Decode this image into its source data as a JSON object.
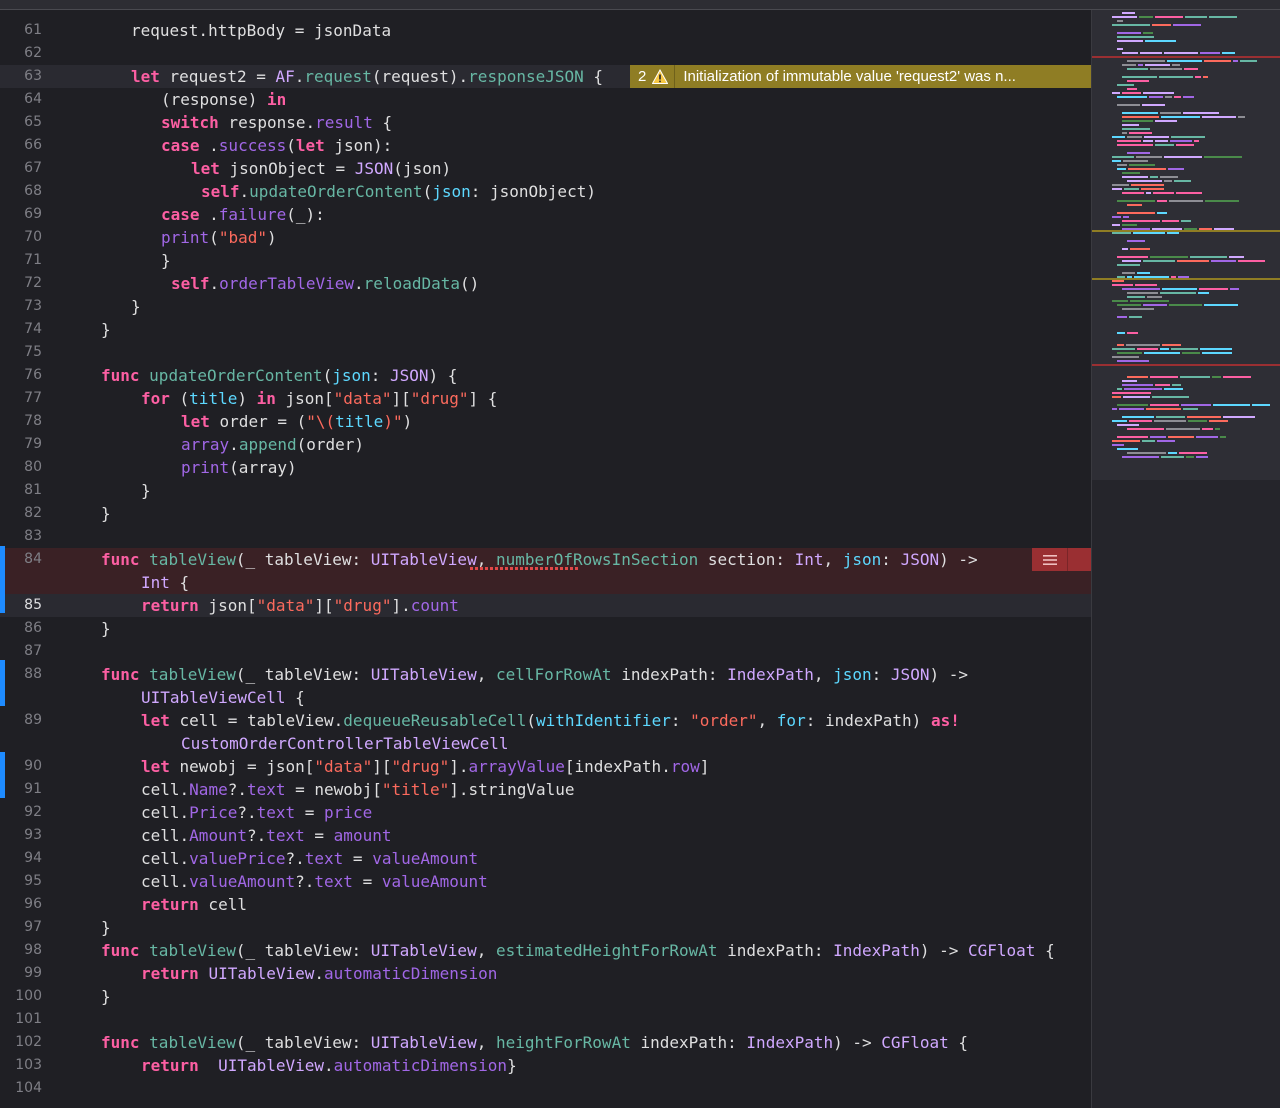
{
  "colors": {
    "keyword": "#fc5fa3",
    "type": "#d0a8ff",
    "function": "#67b7a4",
    "property": "#a167e6",
    "parameter_label": "#5dd8ff",
    "string": "#fc6a5d",
    "plain": "#dfdfe0",
    "warning_bg": "#8f7d24",
    "error_bg": "#9a2f32",
    "change_marker": "#1e8bff"
  },
  "editor": {
    "lines": [
      {
        "n": "61",
        "indent": 131,
        "tokens": [
          [
            "request.httpBody = jsonData",
            "pl"
          ]
        ]
      },
      {
        "n": "62",
        "indent": 131,
        "tokens": []
      },
      {
        "n": "63",
        "indent": 131,
        "hl": true,
        "tokens": [
          [
            "let",
            "k"
          ],
          [
            " request2 = ",
            "pl"
          ],
          [
            "AF",
            "ty"
          ],
          [
            ".",
            "pl"
          ],
          [
            "request",
            "fn"
          ],
          [
            "(request).",
            "pl"
          ],
          [
            "responseJSON",
            "fn"
          ],
          [
            " {",
            "pl"
          ]
        ]
      },
      {
        "n": "64",
        "indent": 161,
        "tokens": [
          [
            "(response) ",
            "pl"
          ],
          [
            "in",
            "k"
          ]
        ]
      },
      {
        "n": "65",
        "indent": 161,
        "tokens": [
          [
            "switch",
            "k"
          ],
          [
            " response.",
            "pl"
          ],
          [
            "result",
            "pr"
          ],
          [
            " {",
            "pl"
          ]
        ]
      },
      {
        "n": "66",
        "indent": 161,
        "tokens": [
          [
            "case",
            "k"
          ],
          [
            " .",
            "pl"
          ],
          [
            "success",
            "pr"
          ],
          [
            "(",
            "pl"
          ],
          [
            "let",
            "k"
          ],
          [
            " json):",
            "pl"
          ]
        ]
      },
      {
        "n": "67",
        "indent": 191,
        "tokens": [
          [
            "let",
            "k"
          ],
          [
            " jsonObject = ",
            "pl"
          ],
          [
            "JSON",
            "ty"
          ],
          [
            "(json)",
            "pl"
          ]
        ]
      },
      {
        "n": "68",
        "indent": 201,
        "tokens": [
          [
            "self",
            "k"
          ],
          [
            ".",
            "pl"
          ],
          [
            "updateOrderContent",
            "fn"
          ],
          [
            "(",
            "pl"
          ],
          [
            "json",
            "lp"
          ],
          [
            ": jsonObject)",
            "pl"
          ]
        ]
      },
      {
        "n": "69",
        "indent": 161,
        "tokens": [
          [
            "case",
            "k"
          ],
          [
            " .",
            "pl"
          ],
          [
            "failure",
            "pr"
          ],
          [
            "(_):",
            "pl"
          ]
        ]
      },
      {
        "n": "70",
        "indent": 161,
        "tokens": [
          [
            "print",
            "pr"
          ],
          [
            "(",
            "pl"
          ],
          [
            "\"bad\"",
            "st"
          ],
          [
            ")",
            "pl"
          ]
        ]
      },
      {
        "n": "71",
        "indent": 161,
        "tokens": [
          [
            "}",
            "pl"
          ]
        ]
      },
      {
        "n": "72",
        "indent": 171,
        "tokens": [
          [
            "self",
            "k"
          ],
          [
            ".",
            "pl"
          ],
          [
            "orderTableView",
            "pr"
          ],
          [
            ".",
            "pl"
          ],
          [
            "reloadData",
            "fn"
          ],
          [
            "()",
            "pl"
          ]
        ]
      },
      {
        "n": "73",
        "indent": 131,
        "tokens": [
          [
            "}",
            "pl"
          ]
        ]
      },
      {
        "n": "74",
        "indent": 101,
        "tokens": [
          [
            "}",
            "pl"
          ]
        ]
      },
      {
        "n": "75",
        "indent": 101,
        "tokens": []
      },
      {
        "n": "76",
        "indent": 101,
        "tokens": [
          [
            "func",
            "k"
          ],
          [
            " ",
            "pl"
          ],
          [
            "updateOrderContent",
            "fn"
          ],
          [
            "(",
            "pl"
          ],
          [
            "json",
            "lp"
          ],
          [
            ": ",
            "pl"
          ],
          [
            "JSON",
            "ty"
          ],
          [
            ") {",
            "pl"
          ]
        ]
      },
      {
        "n": "77",
        "indent": 141,
        "tokens": [
          [
            "for",
            "k"
          ],
          [
            " (",
            "pl"
          ],
          [
            "title",
            "lp"
          ],
          [
            ") ",
            "pl"
          ],
          [
            "in",
            "k"
          ],
          [
            " json[",
            "pl"
          ],
          [
            "\"data\"",
            "st"
          ],
          [
            "][",
            "pl"
          ],
          [
            "\"drug\"",
            "st"
          ],
          [
            "] {",
            "pl"
          ]
        ]
      },
      {
        "n": "78",
        "indent": 181,
        "tokens": [
          [
            "let",
            "k"
          ],
          [
            " order = (",
            "pl"
          ],
          [
            "\"\\(",
            "st"
          ],
          [
            "title",
            "lp"
          ],
          [
            ")\"",
            "st"
          ],
          [
            ")",
            "pl"
          ]
        ]
      },
      {
        "n": "79",
        "indent": 181,
        "tokens": [
          [
            "array",
            "pr"
          ],
          [
            ".",
            "pl"
          ],
          [
            "append",
            "fn"
          ],
          [
            "(order)",
            "pl"
          ]
        ]
      },
      {
        "n": "80",
        "indent": 181,
        "tokens": [
          [
            "print",
            "pr"
          ],
          [
            "(array)",
            "pl"
          ]
        ]
      },
      {
        "n": "81",
        "indent": 141,
        "tokens": [
          [
            "}",
            "pl"
          ]
        ]
      },
      {
        "n": "82",
        "indent": 101,
        "tokens": [
          [
            "}",
            "pl"
          ]
        ]
      },
      {
        "n": "83",
        "indent": 101,
        "tokens": []
      },
      {
        "n": "84",
        "indent": 101,
        "err": true,
        "tokens": [
          [
            "func",
            "k"
          ],
          [
            " ",
            "pl"
          ],
          [
            "tableView",
            "fn"
          ],
          [
            "(_ tableView: ",
            "pl"
          ],
          [
            "UITableView",
            "ty"
          ],
          [
            ", ",
            "pl"
          ],
          [
            "numberOfRowsInSection",
            "fn"
          ],
          [
            " section: ",
            "pl"
          ],
          [
            "Int",
            "ty"
          ],
          [
            ", ",
            "pl"
          ],
          [
            "json",
            "lp"
          ],
          [
            ": ",
            "pl"
          ],
          [
            "JSON",
            "ty"
          ],
          [
            ") ->",
            "pl"
          ]
        ]
      },
      {
        "n": "",
        "indent": 141,
        "err": true,
        "tokens": [
          [
            "Int",
            "ty"
          ],
          [
            " {",
            "pl"
          ]
        ]
      },
      {
        "n": "85",
        "indent": 141,
        "hl": true,
        "cur": true,
        "tokens": [
          [
            "return",
            "k"
          ],
          [
            " json[",
            "pl"
          ],
          [
            "\"data\"",
            "st"
          ],
          [
            "][",
            "pl"
          ],
          [
            "\"drug\"",
            "st"
          ],
          [
            "].",
            "pl"
          ],
          [
            "count",
            "pr"
          ]
        ]
      },
      {
        "n": "86",
        "indent": 101,
        "tokens": [
          [
            "}",
            "pl"
          ]
        ]
      },
      {
        "n": "87",
        "indent": 101,
        "tokens": []
      },
      {
        "n": "88",
        "indent": 101,
        "tokens": [
          [
            "func",
            "k"
          ],
          [
            " ",
            "pl"
          ],
          [
            "tableView",
            "fn"
          ],
          [
            "(_ tableView: ",
            "pl"
          ],
          [
            "UITableView",
            "ty"
          ],
          [
            ", ",
            "pl"
          ],
          [
            "cellForRowAt",
            "fn"
          ],
          [
            " indexPath: ",
            "pl"
          ],
          [
            "IndexPath",
            "ty"
          ],
          [
            ", ",
            "pl"
          ],
          [
            "json",
            "lp"
          ],
          [
            ": ",
            "pl"
          ],
          [
            "JSON",
            "ty"
          ],
          [
            ") ->",
            "pl"
          ]
        ]
      },
      {
        "n": "",
        "indent": 141,
        "tokens": [
          [
            "UITableViewCell",
            "ty"
          ],
          [
            " {",
            "pl"
          ]
        ]
      },
      {
        "n": "89",
        "indent": 141,
        "tokens": [
          [
            "let",
            "k"
          ],
          [
            " cell = tableView.",
            "pl"
          ],
          [
            "dequeueReusableCell",
            "fn"
          ],
          [
            "(",
            "pl"
          ],
          [
            "withIdentifier",
            "lp"
          ],
          [
            ": ",
            "pl"
          ],
          [
            "\"order\"",
            "st"
          ],
          [
            ", ",
            "pl"
          ],
          [
            "for",
            "lp"
          ],
          [
            ": indexPath) ",
            "pl"
          ],
          [
            "as!",
            "k"
          ]
        ]
      },
      {
        "n": "",
        "indent": 181,
        "tokens": [
          [
            "CustomOrderControllerTableViewCell",
            "ty"
          ]
        ]
      },
      {
        "n": "90",
        "indent": 141,
        "tokens": [
          [
            "let",
            "k"
          ],
          [
            " newobj = json[",
            "pl"
          ],
          [
            "\"data\"",
            "st"
          ],
          [
            "][",
            "pl"
          ],
          [
            "\"drug\"",
            "st"
          ],
          [
            "].",
            "pl"
          ],
          [
            "arrayValue",
            "pr"
          ],
          [
            "[indexPath.",
            "pl"
          ],
          [
            "row",
            "pr"
          ],
          [
            "]",
            "pl"
          ]
        ]
      },
      {
        "n": "91",
        "indent": 141,
        "tokens": [
          [
            "cell.",
            "pl"
          ],
          [
            "Name",
            "pr"
          ],
          [
            "?.",
            "pl"
          ],
          [
            "text",
            "pr"
          ],
          [
            " = newobj[",
            "pl"
          ],
          [
            "\"title\"",
            "st"
          ],
          [
            "].stringValue",
            "pl"
          ]
        ]
      },
      {
        "n": "92",
        "indent": 141,
        "tokens": [
          [
            "cell.",
            "pl"
          ],
          [
            "Price",
            "pr"
          ],
          [
            "?.",
            "pl"
          ],
          [
            "text",
            "pr"
          ],
          [
            " = ",
            "pl"
          ],
          [
            "price",
            "pr"
          ]
        ]
      },
      {
        "n": "93",
        "indent": 141,
        "tokens": [
          [
            "cell.",
            "pl"
          ],
          [
            "Amount",
            "pr"
          ],
          [
            "?.",
            "pl"
          ],
          [
            "text",
            "pr"
          ],
          [
            " = ",
            "pl"
          ],
          [
            "amount",
            "pr"
          ]
        ]
      },
      {
        "n": "94",
        "indent": 141,
        "tokens": [
          [
            "cell.",
            "pl"
          ],
          [
            "valuePrice",
            "pr"
          ],
          [
            "?.",
            "pl"
          ],
          [
            "text",
            "pr"
          ],
          [
            " = ",
            "pl"
          ],
          [
            "valueAmount",
            "pr"
          ]
        ]
      },
      {
        "n": "95",
        "indent": 141,
        "tokens": [
          [
            "cell.",
            "pl"
          ],
          [
            "valueAmount",
            "pr"
          ],
          [
            "?.",
            "pl"
          ],
          [
            "text",
            "pr"
          ],
          [
            " = ",
            "pl"
          ],
          [
            "valueAmount",
            "pr"
          ]
        ]
      },
      {
        "n": "96",
        "indent": 141,
        "tokens": [
          [
            "return",
            "k"
          ],
          [
            " cell",
            "pl"
          ]
        ]
      },
      {
        "n": "97",
        "indent": 101,
        "tokens": [
          [
            "}",
            "pl"
          ]
        ]
      },
      {
        "n": "98",
        "indent": 101,
        "tokens": [
          [
            "func",
            "k"
          ],
          [
            " ",
            "pl"
          ],
          [
            "tableView",
            "fn"
          ],
          [
            "(_ tableView: ",
            "pl"
          ],
          [
            "UITableView",
            "ty"
          ],
          [
            ", ",
            "pl"
          ],
          [
            "estimatedHeightForRowAt",
            "fn"
          ],
          [
            " indexPath: ",
            "pl"
          ],
          [
            "IndexPath",
            "ty"
          ],
          [
            ") -> ",
            "pl"
          ],
          [
            "CGFloat",
            "ty"
          ],
          [
            " {",
            "pl"
          ]
        ]
      },
      {
        "n": "99",
        "indent": 141,
        "tokens": [
          [
            "return",
            "k"
          ],
          [
            " ",
            "pl"
          ],
          [
            "UITableView",
            "ty"
          ],
          [
            ".",
            "pl"
          ],
          [
            "automaticDimension",
            "pr"
          ]
        ]
      },
      {
        "n": "100",
        "indent": 101,
        "tokens": [
          [
            "}",
            "pl"
          ]
        ]
      },
      {
        "n": "101",
        "indent": 101,
        "tokens": []
      },
      {
        "n": "102",
        "indent": 101,
        "tokens": [
          [
            "func",
            "k"
          ],
          [
            " ",
            "pl"
          ],
          [
            "tableView",
            "fn"
          ],
          [
            "(_ tableView: ",
            "pl"
          ],
          [
            "UITableView",
            "ty"
          ],
          [
            ", ",
            "pl"
          ],
          [
            "heightForRowAt",
            "fn"
          ],
          [
            " indexPath: ",
            "pl"
          ],
          [
            "IndexPath",
            "ty"
          ],
          [
            ") -> ",
            "pl"
          ],
          [
            "CGFloat",
            "ty"
          ],
          [
            " {",
            "pl"
          ]
        ]
      },
      {
        "n": "103",
        "indent": 141,
        "tokens": [
          [
            "return",
            "k"
          ],
          [
            "  ",
            "pl"
          ],
          [
            "UITableView",
            "ty"
          ],
          [
            ".",
            "pl"
          ],
          [
            "automaticDimension",
            "pr"
          ],
          [
            "}",
            "pl"
          ]
        ]
      },
      {
        "n": "104",
        "indent": 101,
        "tokens": []
      }
    ],
    "warning": {
      "count": "2",
      "message": "Initialization of immutable value 'request2' was n...",
      "icon": "warning-triangle-icon"
    },
    "error": {
      "icon": "error-list-icon"
    }
  }
}
